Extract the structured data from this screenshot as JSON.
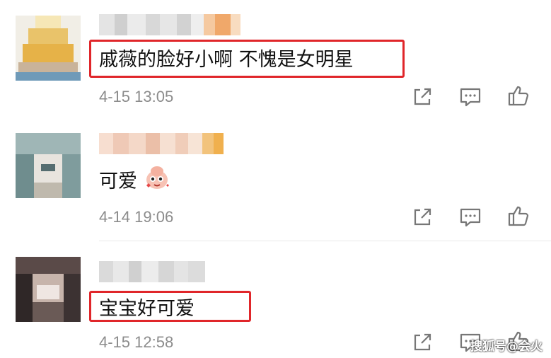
{
  "comments": [
    {
      "text": "戚薇的脸好小啊 不愧是女明星",
      "time": "4-15 13:05",
      "highlighted": true,
      "avatar_colors": [
        "#f6e7b6",
        "#e9c36a",
        "#e6b248",
        "#dcd1bc",
        "#c9b39a",
        "#8fb2c8",
        "#6f9ab8"
      ]
    },
    {
      "text": "可爱",
      "time": "4-14 19:06",
      "highlighted": false,
      "has_emoji": true,
      "avatar_colors": [
        "#dde7e6",
        "#9fb6b6",
        "#6f8d8e",
        "#e8e4de",
        "#bfb9ad",
        "#556d70"
      ]
    },
    {
      "text": "宝宝好可爱",
      "time": "4-15 12:58",
      "highlighted": true,
      "avatar_colors": [
        "#5a4a48",
        "#8a7470",
        "#2f2727",
        "#c7b4ab",
        "#efe6e2",
        "#3c3232"
      ]
    }
  ],
  "actions": {
    "share_icon": "share-icon",
    "reply_icon": "comment-icon",
    "like_icon": "thumbs-up-icon"
  },
  "watermark": "搜狐号@会火",
  "colors": {
    "highlight": "#e0262a",
    "meta": "#8c8c8c",
    "icon": "#777777"
  }
}
